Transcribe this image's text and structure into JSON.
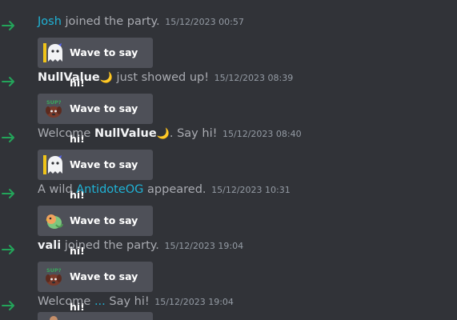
{
  "messages": [
    {
      "prefix": "",
      "name": "Josh",
      "name_style": "blue",
      "moon": "",
      "suffix": " joined the party.",
      "timestamp": "15/12/2023 00:57",
      "button": "Wave to say hi!",
      "sticker": "ghost-sticker-icon"
    },
    {
      "prefix": "",
      "name": "NullValue",
      "name_style": "bold",
      "moon": "🌙",
      "suffix": " just showed up!",
      "timestamp": "15/12/2023 08:39",
      "button": "Wave to say hi!",
      "sticker": "sup-dog-sticker-icon"
    },
    {
      "prefix": "Welcome ",
      "name": "NullValue",
      "name_style": "bold",
      "moon": "🌙",
      "suffix": ". Say hi!",
      "timestamp": "15/12/2023 08:40",
      "button": "Wave to say hi!",
      "sticker": "ghost-sticker-icon"
    },
    {
      "prefix": "A wild ",
      "name": "AntidoteOG",
      "name_style": "blue",
      "moon": "",
      "suffix": " appeared.",
      "timestamp": "15/12/2023 10:31",
      "button": "Wave to say hi!",
      "sticker": "bird-sticker-icon"
    },
    {
      "prefix": "",
      "name": "vali",
      "name_style": "bold",
      "moon": "",
      "suffix": " joined the party.",
      "timestamp": "15/12/2023 19:04",
      "button": "Wave to say hi!",
      "sticker": "sup-dog-sticker-icon"
    },
    {
      "prefix": "Welcome ",
      "name": "...",
      "name_style": "blue",
      "moon": "",
      "suffix": " Say hi!",
      "timestamp": "15/12/2023 19:04",
      "button": "Wave to say hi!",
      "sticker": "sticker-icon"
    }
  ],
  "colors": {
    "background": "#313338",
    "arrow": "#23a55a",
    "username_blue": "#1fb3d6",
    "button": "#4e5058"
  },
  "icons": {
    "arrow": "join-arrow-icon"
  }
}
